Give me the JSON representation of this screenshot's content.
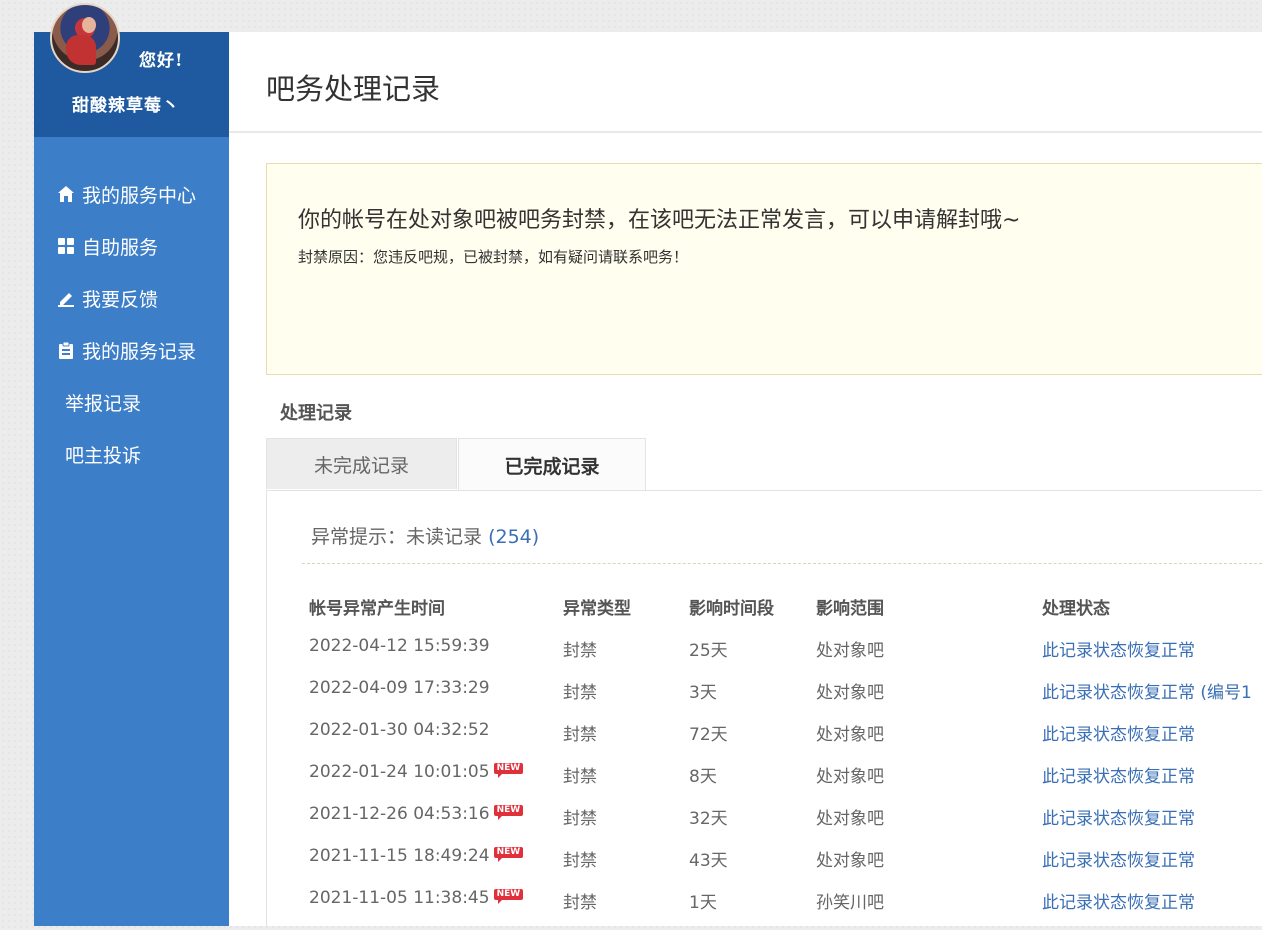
{
  "sidebar": {
    "greeting": "您好!",
    "username": "甜酸辣草莓丶",
    "items": [
      {
        "label": "我的服务中心",
        "icon": "home-icon"
      },
      {
        "label": "自助服务",
        "icon": "grid-icon"
      },
      {
        "label": "我要反馈",
        "icon": "edit-icon"
      },
      {
        "label": "我的服务记录",
        "icon": "clipboard-icon"
      },
      {
        "label": "举报记录"
      },
      {
        "label": "吧主投诉"
      }
    ]
  },
  "page": {
    "title": "吧务处理记录"
  },
  "notice": {
    "message": "你的帐号在处对象吧被吧务封禁，在该吧无法正常发言，可以申请解封哦~",
    "reason": "封禁原因：您违反吧规，已被封禁，如有疑问请联系吧务！"
  },
  "records": {
    "section_title": "处理记录",
    "tabs": {
      "pending": "未完成记录",
      "done": "已完成记录"
    },
    "hint_label": "异常提示：未读记录",
    "hint_count": "(254)",
    "columns": [
      "帐号异常产生时间",
      "异常类型",
      "影响时间段",
      "影响范围",
      "处理状态"
    ],
    "new_badge": "NEW",
    "rows": [
      {
        "time": "2022-04-12 15:59:39",
        "type": "封禁",
        "duration": "25天",
        "scope": "处对象吧",
        "status": "此记录状态恢复正常",
        "new": false
      },
      {
        "time": "2022-04-09 17:33:29",
        "type": "封禁",
        "duration": "3天",
        "scope": "处对象吧",
        "status": "此记录状态恢复正常 (编号1",
        "new": false
      },
      {
        "time": "2022-01-30 04:32:52",
        "type": "封禁",
        "duration": "72天",
        "scope": "处对象吧",
        "status": "此记录状态恢复正常",
        "new": false
      },
      {
        "time": "2022-01-24 10:01:05",
        "type": "封禁",
        "duration": "8天",
        "scope": "处对象吧",
        "status": "此记录状态恢复正常",
        "new": true
      },
      {
        "time": "2021-12-26 04:53:16",
        "type": "封禁",
        "duration": "32天",
        "scope": "处对象吧",
        "status": "此记录状态恢复正常",
        "new": true
      },
      {
        "time": "2021-11-15 18:49:24",
        "type": "封禁",
        "duration": "43天",
        "scope": "处对象吧",
        "status": "此记录状态恢复正常",
        "new": true
      },
      {
        "time": "2021-11-05 11:38:45",
        "type": "封禁",
        "duration": "1天",
        "scope": "孙笑川吧",
        "status": "此记录状态恢复正常",
        "new": true
      }
    ]
  },
  "colors": {
    "sidebar": "#3d7ec8",
    "sidebar_header": "#1f5aa0",
    "link": "#3a6fb6",
    "notice_bg": "#fffeef",
    "new_badge": "#e0303a"
  }
}
